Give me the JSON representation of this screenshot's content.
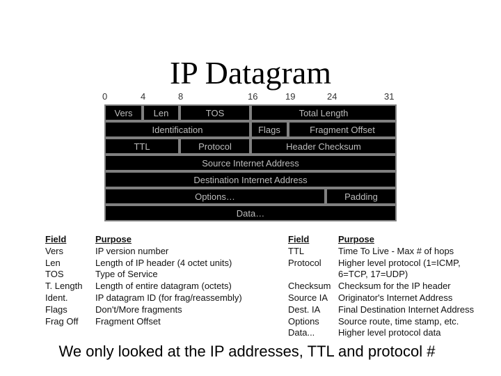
{
  "title": "IP Datagram",
  "bit_positions": [
    "0",
    "4",
    "8",
    "16",
    "19",
    "24",
    "31"
  ],
  "header_rows": [
    [
      {
        "label": "Vers",
        "bits": [
          0,
          4
        ]
      },
      {
        "label": "Len",
        "bits": [
          4,
          8
        ]
      },
      {
        "label": "TOS",
        "bits": [
          8,
          16
        ]
      },
      {
        "label": "Total Length",
        "bits": [
          16,
          32
        ]
      }
    ],
    [
      {
        "label": "Identification",
        "bits": [
          0,
          16
        ]
      },
      {
        "label": "Flags",
        "bits": [
          16,
          19
        ]
      },
      {
        "label": "Fragment Offset",
        "bits": [
          19,
          32
        ]
      }
    ],
    [
      {
        "label": "TTL",
        "bits": [
          0,
          8
        ]
      },
      {
        "label": "Protocol",
        "bits": [
          8,
          16
        ]
      },
      {
        "label": "Header Checksum",
        "bits": [
          16,
          32
        ]
      }
    ],
    [
      {
        "label": "Source Internet Address",
        "bits": [
          0,
          32
        ]
      }
    ],
    [
      {
        "label": "Destination Internet Address",
        "bits": [
          0,
          32
        ]
      }
    ],
    [
      {
        "label": "Options…",
        "bits": [
          0,
          24
        ]
      },
      {
        "label": "Padding",
        "bits": [
          24,
          32
        ]
      }
    ],
    [
      {
        "label": "Data…",
        "bits": [
          0,
          32
        ]
      }
    ]
  ],
  "left_table": {
    "headers": [
      "Field",
      "Purpose"
    ],
    "rows": [
      [
        "Vers",
        "IP version number"
      ],
      [
        "Len",
        "Length of IP header (4 octet units)"
      ],
      [
        "TOS",
        "Type of Service"
      ],
      [
        "T. Length",
        "Length of entire datagram (octets)"
      ],
      [
        "Ident.",
        "IP datagram ID (for frag/reassembly)"
      ],
      [
        "Flags",
        "Don't/More fragments"
      ],
      [
        "Frag Off",
        "Fragment Offset"
      ]
    ]
  },
  "right_table": {
    "headers": [
      "Field",
      "Purpose"
    ],
    "rows": [
      [
        "TTL",
        "Time To Live - Max # of hops"
      ],
      [
        "Protocol",
        "Higher level protocol (1=ICMP,"
      ],
      [
        "",
        "6=TCP, 17=UDP)"
      ],
      [
        "Checksum",
        "Checksum for the IP header"
      ],
      [
        "Source IA",
        "Originator's Internet Address"
      ],
      [
        "Dest. IA",
        "Final Destination Internet Address"
      ],
      [
        "Options",
        "Source route, time stamp, etc."
      ],
      [
        "Data...",
        "Higher level protocol data"
      ]
    ]
  },
  "footer": "We only looked at the IP addresses, TTL and protocol #",
  "colors": {
    "cell_fill": "#000000",
    "cell_border": "#808080",
    "cell_text": "#bdbdbd"
  }
}
